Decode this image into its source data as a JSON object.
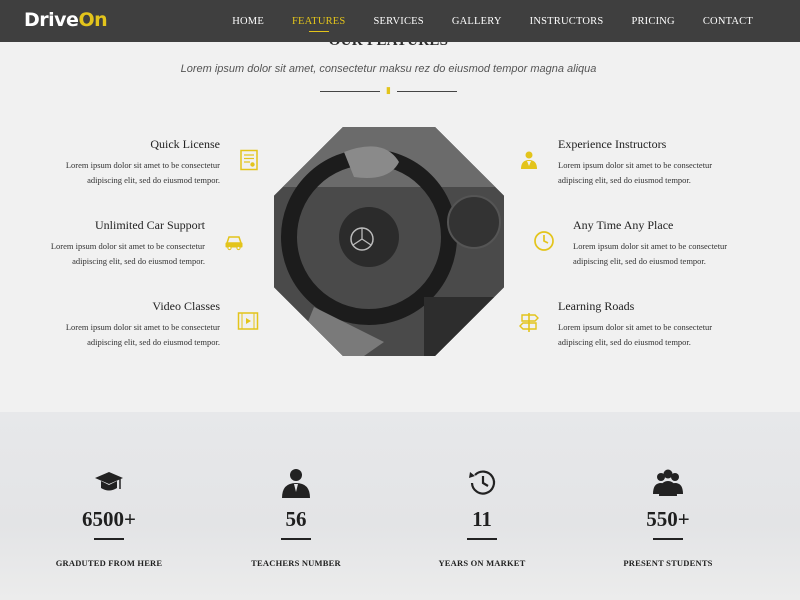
{
  "brand": {
    "name_prefix": "Drive",
    "name_suffix": "On"
  },
  "nav": {
    "items": [
      "HOME",
      "FEATURES",
      "SERVICES",
      "GALLERY",
      "INSTRUCTORS",
      "PRICING",
      "CONTACT"
    ],
    "active": "FEATURES"
  },
  "features": {
    "title": "OUR FEATURES",
    "subtitle": "Lorem ipsum dolor sit amet, consectetur maksu rez do eiusmod tempor magna aliqua",
    "left": [
      {
        "title": "Quick License",
        "text1": "Lorem ipsum dolor sit amet to be consectetur",
        "text2": "adipiscing elit, sed do eiusmod tempor.",
        "icon": "license-icon"
      },
      {
        "title": "Unlimited Car Support",
        "text1": "Lorem ipsum dolor sit amet to be consectetur",
        "text2": "adipiscing elit, sed do eiusmod tempor.",
        "icon": "car-icon"
      },
      {
        "title": "Video Classes",
        "text1": "Lorem ipsum dolor sit amet to be consectetur",
        "text2": "adipiscing elit, sed do eiusmod tempor.",
        "icon": "video-icon"
      }
    ],
    "right": [
      {
        "title": "Experience Instructors",
        "text1": "Lorem ipsum dolor sit amet to be consectetur",
        "text2": "adipiscing elit, sed do eiusmod tempor.",
        "icon": "instructor-icon"
      },
      {
        "title": "Any Time Any Place",
        "text1": "Lorem ipsum dolor sit amet to be consectetur",
        "text2": "adipiscing elit, sed do eiusmod tempor.",
        "icon": "clock-icon"
      },
      {
        "title": "Learning Roads",
        "text1": "Lorem ipsum dolor sit amet to be consectetur",
        "text2": "adipiscing elit, sed do eiusmod tempor.",
        "icon": "signpost-icon"
      }
    ]
  },
  "stats": [
    {
      "value": "6500+",
      "label": "GRADUTED FROM HERE",
      "icon": "graduation-cap-icon"
    },
    {
      "value": "56",
      "label": "TEACHERS NUMBER",
      "icon": "teacher-icon"
    },
    {
      "value": "11",
      "label": "YEARS ON MARKET",
      "icon": "history-icon"
    },
    {
      "value": "550+",
      "label": "PRESENT STUDENTS",
      "icon": "students-icon"
    }
  ],
  "colors": {
    "accent": "#e3c41b",
    "navbar": "#3f3f3f",
    "background": "#f1f1f1"
  }
}
